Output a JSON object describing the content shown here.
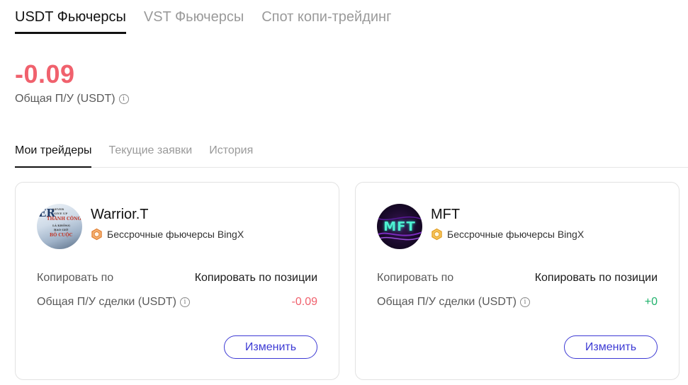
{
  "top_tabs": [
    {
      "label": "USDT Фьючерсы",
      "active": true
    },
    {
      "label": "VST Фьючерсы",
      "active": false
    },
    {
      "label": "Спот копи-трейдинг",
      "active": false
    }
  ],
  "summary": {
    "pnl_value": "-0.09",
    "pnl_label": "Общая П/У (USDT)"
  },
  "sub_tabs": [
    {
      "label": "Мои трейдеры",
      "active": true
    },
    {
      "label": "Текущие заявки",
      "active": false
    },
    {
      "label": "История",
      "active": false
    }
  ],
  "traders": [
    {
      "name": "Warrior.T",
      "badge_text": "Бессрочные фьючерсы BingX",
      "copy_by_label": "Копировать по",
      "copy_by_value": "Копировать по позиции",
      "pnl_label": "Общая П/У сделки (USDT)",
      "pnl_value": "-0.09",
      "edit_label": "Изменить",
      "avatar_text": {
        "left": "ER",
        "l1": "NEVER",
        "l2": "GIVE UP",
        "l3": "THÀNH CÔNG",
        "l4": "LÀ KHÔNG",
        "l5": "BAO GIỜ",
        "l6": "BỎ CUỘC"
      }
    },
    {
      "name": "MFT",
      "badge_text": "Бессрочные фьючерсы BingX",
      "copy_by_label": "Копировать по",
      "copy_by_value": "Копировать по позиции",
      "pnl_label": "Общая П/У сделки (USDT)",
      "pnl_value": "+0",
      "edit_label": "Изменить",
      "avatar_text": "MFT"
    }
  ],
  "colors": {
    "negative": "#f0616d",
    "positive": "#20b26c",
    "accent": "#3d3ad4",
    "badge": "#e98a3a"
  },
  "icons": {
    "info": "info-circle-icon",
    "badge": "hexagon-badge-icon"
  }
}
